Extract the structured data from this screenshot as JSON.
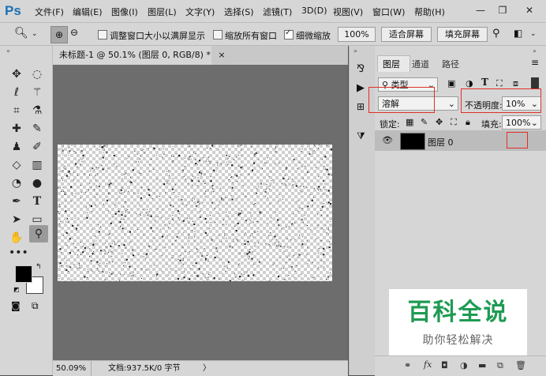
{
  "app": {
    "logo": "Ps"
  },
  "menu": {
    "items": [
      "文件(F)",
      "编辑(E)",
      "图像(I)",
      "图层(L)",
      "文字(Y)",
      "选择(S)",
      "滤镜(T)",
      "3D(D)",
      "视图(V)",
      "窗口(W)",
      "帮助(H)"
    ]
  },
  "window_controls": {
    "minimize": "—",
    "restore": "❐",
    "close": "✕"
  },
  "options": {
    "resize_windows_label": "调整窗口大小以满屏显示",
    "zoom_all_windows_label": "缩放所有窗口",
    "scrubby_zoom_label": "细微缩放",
    "scrubby_zoom_checked": true,
    "zoom_100_button": "100%",
    "fit_screen_button": "适合屏幕",
    "fill_screen_button": "填充屏幕"
  },
  "document": {
    "tab_title": "未标题-1 @ 50.1% (图层 0, RGB/8) *",
    "tab_close": "×",
    "zoom": "50.09%",
    "doc_info": "文档:937.5K/0 字节",
    "status_arrow": "〉"
  },
  "layers_panel": {
    "tabs": [
      "图层",
      "通道",
      "路径"
    ],
    "filter_kind": "类型",
    "blend_mode": "溶解",
    "opacity_label": "不透明度:",
    "opacity_value": "10%",
    "lock_label": "锁定:",
    "fill_label": "填充:",
    "fill_value": "100%",
    "layers": [
      {
        "name": "图层 0",
        "visible": true
      }
    ]
  },
  "watermark": {
    "title": "百科全说",
    "subtitle": "助你轻松解决"
  },
  "colors": {
    "accent_red": "#e0302a",
    "watermark_green": "#1f9b53",
    "ps_blue": "#1b6fb5"
  },
  "icons": {
    "tools": [
      "move-icon",
      "marquee-icon",
      "lasso-icon",
      "magic-wand-icon",
      "crop-icon",
      "eyedropper-icon",
      "healing-brush-icon",
      "brush-icon",
      "stamp-icon",
      "history-brush-icon",
      "eraser-icon",
      "gradient-icon",
      "blur-icon",
      "dodge-icon",
      "pen-icon",
      "type-icon",
      "path-select-icon",
      "rectangle-icon",
      "hand-icon",
      "zoom-icon",
      "more-tools-icon"
    ]
  }
}
